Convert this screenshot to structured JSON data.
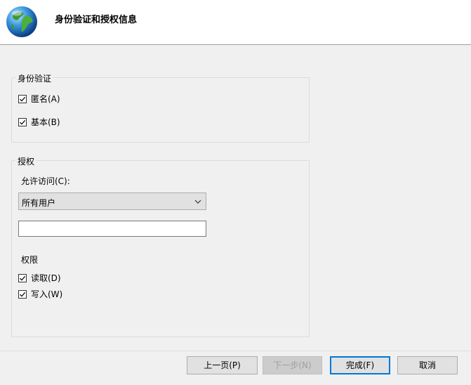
{
  "header": {
    "title": "身份验证和授权信息"
  },
  "authentication": {
    "group_title": "身份验证",
    "anonymous": {
      "label": "匿名(A)",
      "checked": true
    },
    "basic": {
      "label": "基本(B)",
      "checked": true
    }
  },
  "authorization": {
    "group_title": "授权",
    "allow_access_label": "允许访问(C):",
    "allow_access_selected": "所有用户",
    "user_input_value": "",
    "permissions_label": "权限",
    "read": {
      "label": "读取(D)",
      "checked": true
    },
    "write": {
      "label": "写入(W)",
      "checked": true
    }
  },
  "buttons": {
    "previous": "上一页(P)",
    "next": "下一步(N)",
    "finish": "完成(F)",
    "cancel": "取消"
  }
}
